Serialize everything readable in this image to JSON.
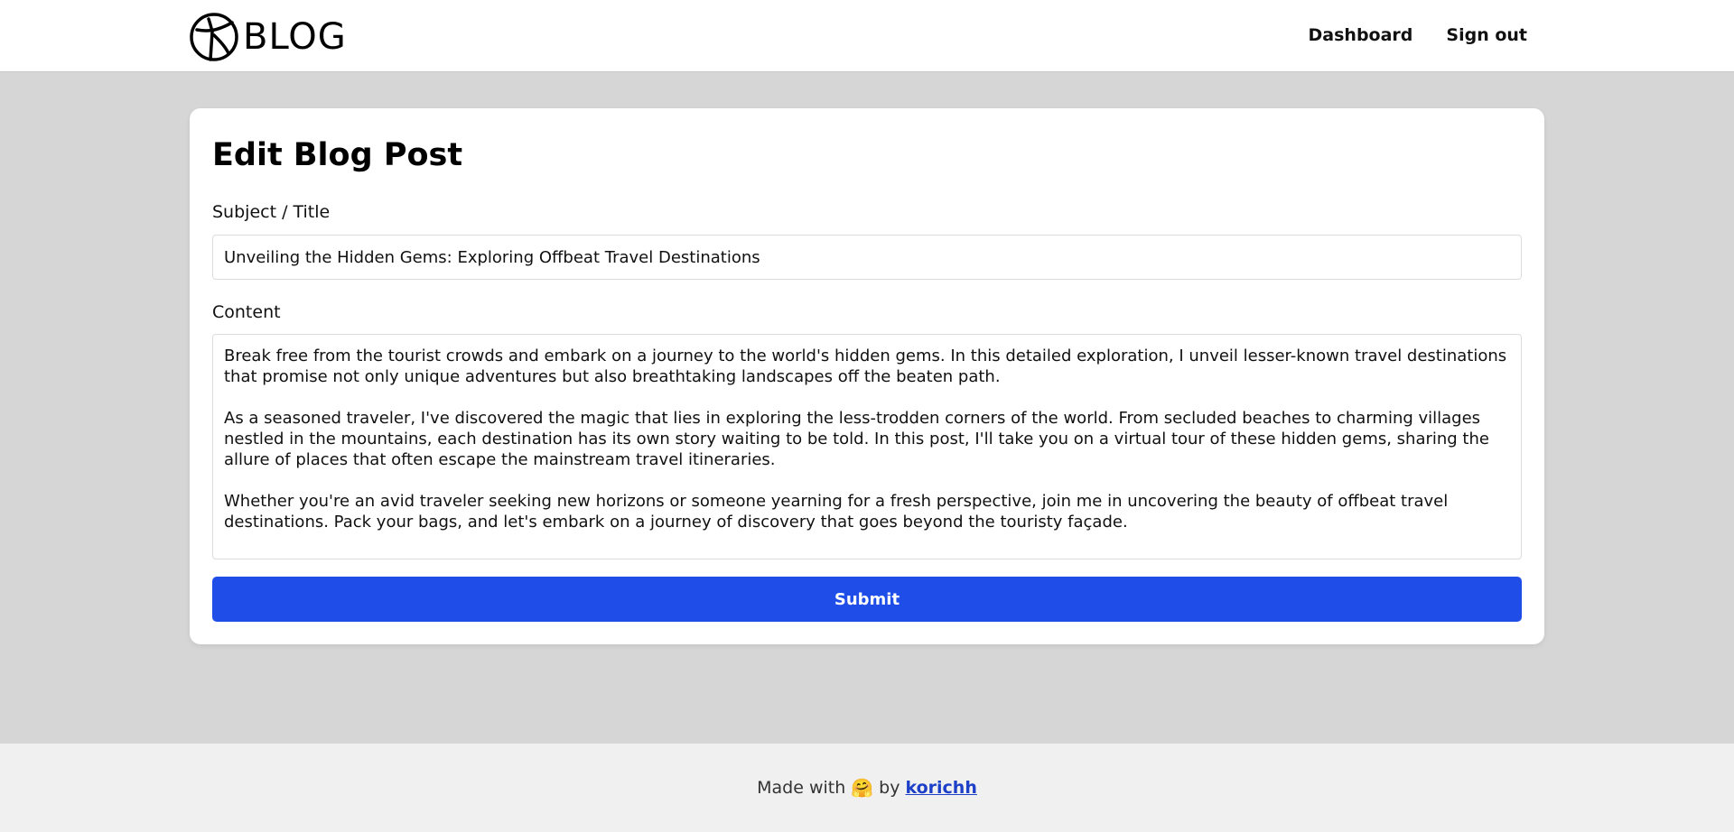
{
  "header": {
    "logo_text": "BLOG",
    "nav": [
      {
        "label": "Dashboard"
      },
      {
        "label": "Sign out"
      }
    ]
  },
  "form": {
    "heading": "Edit Blog Post",
    "title_label": "Subject / Title",
    "title_value": "Unveiling the Hidden Gems: Exploring Offbeat Travel Destinations",
    "content_label": "Content",
    "content_value": "Break free from the tourist crowds and embark on a journey to the world's hidden gems. In this detailed exploration, I unveil lesser-known travel destinations that promise not only unique adventures but also breathtaking landscapes off the beaten path.\n\nAs a seasoned traveler, I've discovered the magic that lies in exploring the less-trodden corners of the world. From secluded beaches to charming villages nestled in the mountains, each destination has its own story waiting to be told. In this post, I'll take you on a virtual tour of these hidden gems, sharing the allure of places that often escape the mainstream travel itineraries.\n\nWhether you're an avid traveler seeking new horizons or someone yearning for a fresh perspective, join me in uncovering the beauty of offbeat travel destinations. Pack your bags, and let's embark on a journey of discovery that goes beyond the touristy façade.",
    "submit_label": "Submit"
  },
  "footer": {
    "made_with": "Made with",
    "emoji": "🤗",
    "by": "by",
    "author": "korichh"
  },
  "colors": {
    "accent": "#1e4de8",
    "page_bg": "#d6d6d6",
    "footer_bg": "#f0f0f0",
    "link": "#1e40c8"
  }
}
